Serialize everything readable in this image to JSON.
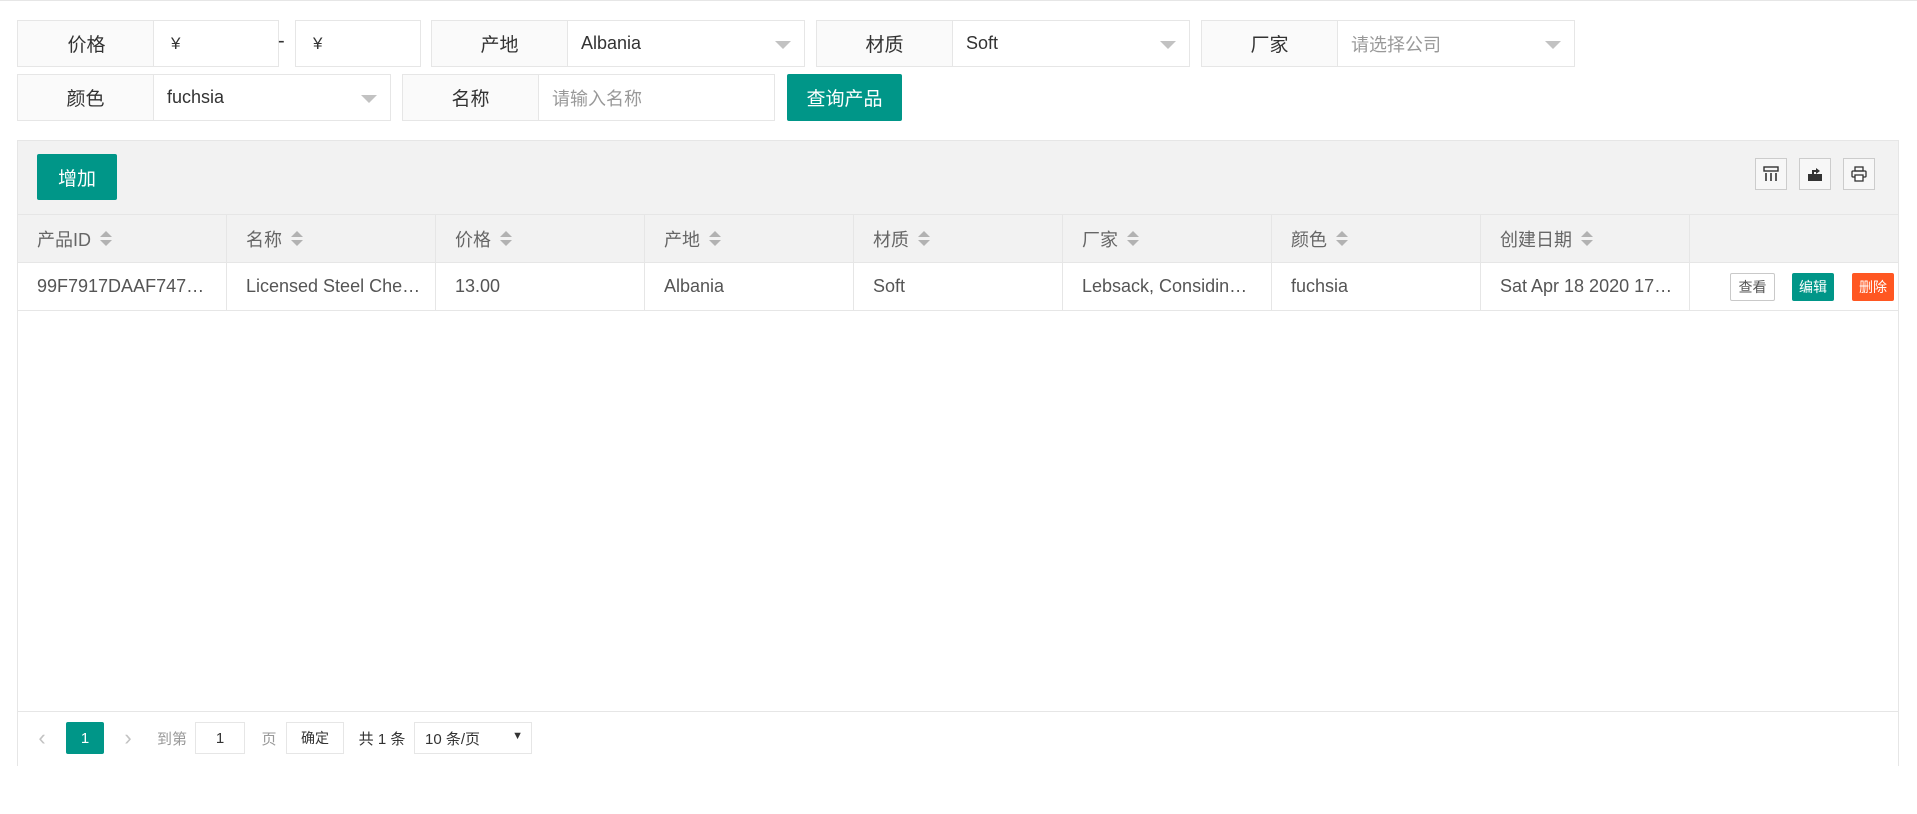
{
  "filters": {
    "price": {
      "label": "价格",
      "min_placeholder": "¥",
      "max_placeholder": "¥",
      "separator": "-"
    },
    "origin": {
      "label": "产地",
      "value": "Albania"
    },
    "material": {
      "label": "材质",
      "value": "Soft"
    },
    "maker": {
      "label": "厂家",
      "placeholder": "请选择公司"
    },
    "color": {
      "label": "颜色",
      "value": "fuchsia"
    },
    "name": {
      "label": "名称",
      "placeholder": "请输入名称"
    },
    "search_button": "查询产品"
  },
  "toolbar": {
    "add_button": "增加",
    "icons": [
      "columns-icon",
      "export-icon",
      "print-icon"
    ]
  },
  "table": {
    "columns": [
      "产品ID",
      "名称",
      "价格",
      "产地",
      "材质",
      "厂家",
      "颜色",
      "创建日期"
    ],
    "rows": [
      {
        "id": "99F7917DAAF747…",
        "name": "Licensed Steel Che…",
        "price": "13.00",
        "origin": "Albania",
        "material": "Soft",
        "maker": "Lebsack, Considin…",
        "color": "fuchsia",
        "created": "Sat Apr 18 2020 17…",
        "actions": {
          "view": "查看",
          "edit": "编辑",
          "delete": "删除"
        }
      }
    ]
  },
  "pagination": {
    "current_page": "1",
    "goto_label": "到第",
    "goto_value": "1",
    "page_suffix": "页",
    "confirm": "确定",
    "total": "共 1 条",
    "page_size": "10 条/页"
  },
  "colors": {
    "primary": "#009688",
    "danger": "#FF5722"
  }
}
